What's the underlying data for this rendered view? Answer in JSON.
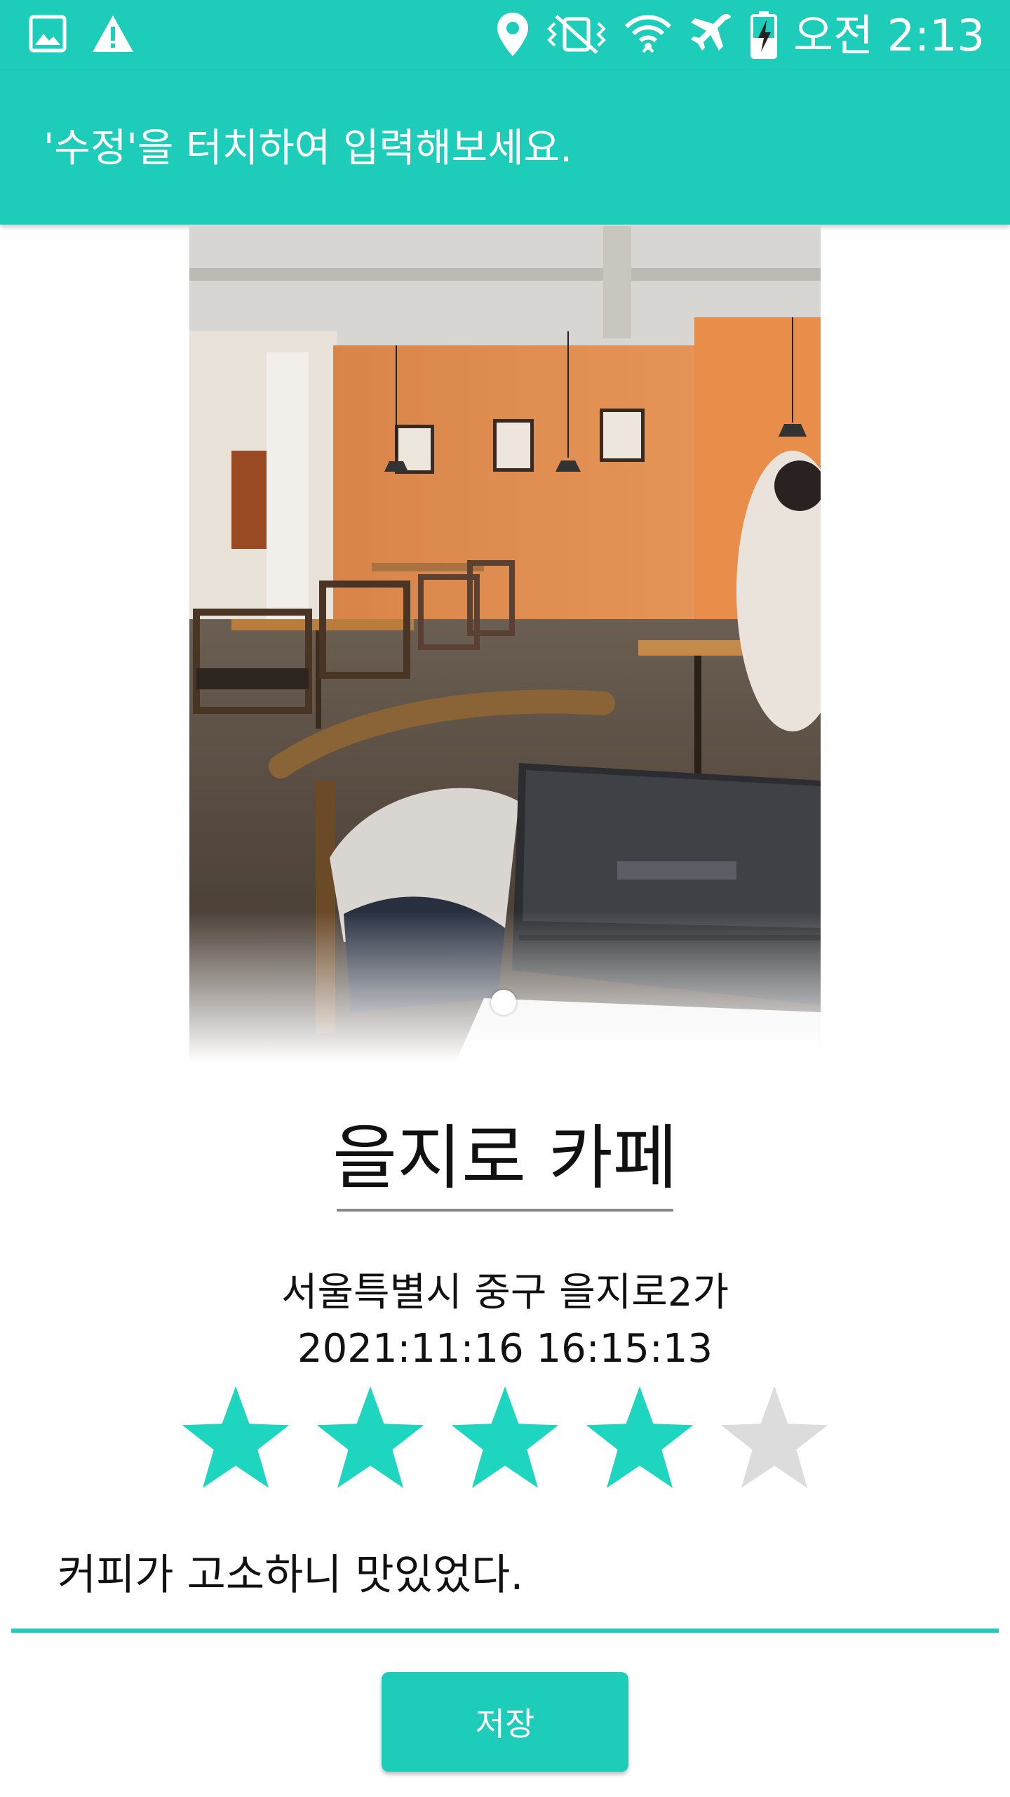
{
  "status_bar": {
    "time": "오전 2:13",
    "background": "#1ecdb9",
    "left_icons": [
      "gallery-icon",
      "warning-icon"
    ],
    "right_icons": [
      "location-icon",
      "vibrate-off-icon",
      "wifi-icon",
      "airplane-icon",
      "battery-charging-icon"
    ]
  },
  "toolbar": {
    "title": "'수정'을 터치하여 입력해보세요."
  },
  "photo": {
    "description_icon": "cafe-photo"
  },
  "place": {
    "title": "을지로 카페",
    "address": "서울특별시 중구 을지로2가",
    "datetime": "2021:11:16 16:15:13"
  },
  "rating": {
    "value": 4,
    "max": 5,
    "filled_color": "#1ed5c0",
    "empty_color": "#dcdcdc"
  },
  "review": {
    "text": "커피가 고소하니 맛있었다."
  },
  "actions": {
    "save_label": "저장"
  },
  "theme": {
    "accent": "#1ecdb9"
  }
}
